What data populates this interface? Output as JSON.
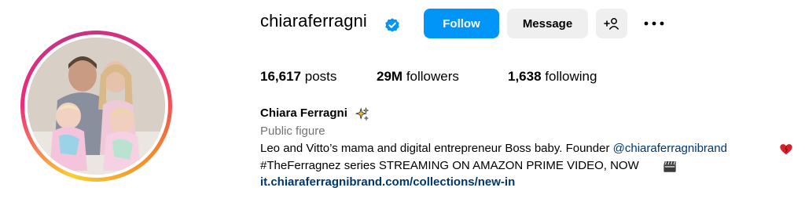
{
  "profile": {
    "username": "chiaraferragni",
    "verified_icon": "verified-badge-icon",
    "full_name": "Chiara Ferragni",
    "category": "Public figure",
    "bio_line1_prefix": "Leo and Vitto’s mama and digital entrepreneur Boss baby. Founder ",
    "bio_mention": "@chiaraferragnibrand",
    "bio_line2": "#TheFerragnez series STREAMING ON AMAZON PRIME VIDEO, NOW",
    "link": "it.chiaraferragnibrand.com/collections/new-in"
  },
  "actions": {
    "follow_label": "Follow",
    "message_label": "Message",
    "add_icon": "add-person-icon",
    "more_icon": "more-options-icon"
  },
  "stats": {
    "posts_count": "16,617",
    "posts_label": "posts",
    "followers_count": "29M",
    "followers_label": "followers",
    "following_count": "1,638",
    "following_label": "following"
  },
  "colors": {
    "follow_button": "#0095f6",
    "link": "#00376b",
    "secondary_text": "#737373",
    "verified": "#0095f6"
  }
}
